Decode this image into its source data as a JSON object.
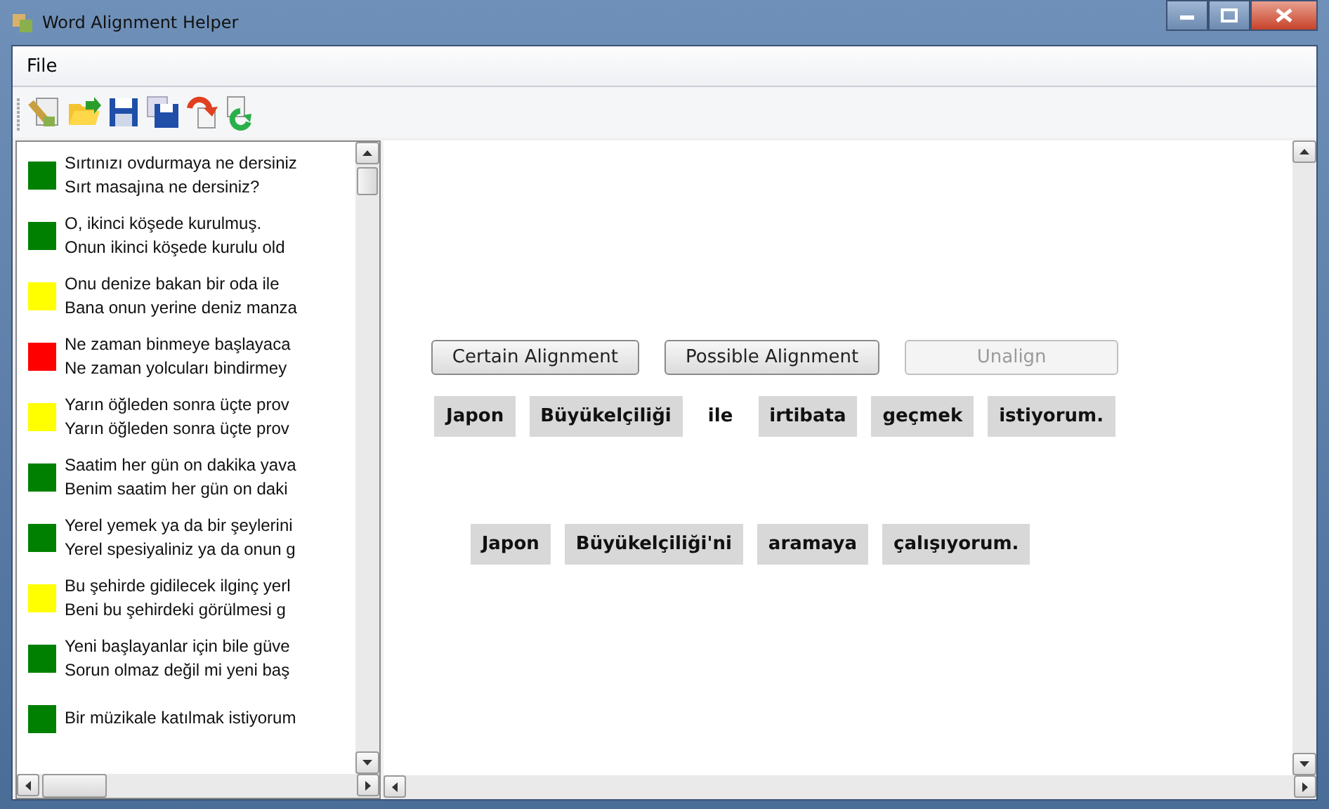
{
  "window": {
    "title": "Word Alignment Helper"
  },
  "menu": [
    "File"
  ],
  "sentences": [
    {
      "color": "#008000",
      "source": "Sırtınızı ovdurmaya ne dersiniz",
      "target": "Sırt masajına ne dersiniz?"
    },
    {
      "color": "#008000",
      "source": "O, ikinci köşede kurulmuş.",
      "target": "Onun ikinci köşede kurulu old"
    },
    {
      "color": "#ffff00",
      "source": "Onu denize bakan bir oda ile",
      "target": "Bana onun yerine deniz manza"
    },
    {
      "color": "#ff0000",
      "source": "Ne zaman binmeye başlayaca",
      "target": "Ne zaman yolcuları bindirmey"
    },
    {
      "color": "#ffff00",
      "source": "Yarın öğleden sonra üçte prov",
      "target": "Yarın öğleden sonra üçte prov"
    },
    {
      "color": "#008000",
      "source": "Saatim her gün on dakika yava",
      "target": "Benim saatim her gün on daki"
    },
    {
      "color": "#008000",
      "source": "Yerel yemek ya da bir şeylerini",
      "target": "Yerel spesiyaliniz ya da onun g"
    },
    {
      "color": "#ffff00",
      "source": "Bu şehirde gidilecek ilginç yerl",
      "target": "Beni bu şehirdeki görülmesi g"
    },
    {
      "color": "#008000",
      "source": "Yeni başlayanlar için bile güve",
      "target": "Sorun olmaz değil mi yeni baş"
    },
    {
      "color": "#008000",
      "source": "Bir müzikale katılmak istiyorum"
    }
  ],
  "buttons": [
    {
      "label": "Certain Alignment",
      "disabled": false
    },
    {
      "label": "Possible Alignment",
      "disabled": false
    },
    {
      "label": "Unalign",
      "disabled": true
    }
  ],
  "source_words": [
    {
      "text": "Japon",
      "highlighted": true
    },
    {
      "text": "Büyükelçiliği",
      "highlighted": true
    },
    {
      "text": "ile",
      "highlighted": false
    },
    {
      "text": "irtibata",
      "highlighted": true
    },
    {
      "text": "geçmek",
      "highlighted": true
    },
    {
      "text": "istiyorum.",
      "highlighted": true
    }
  ],
  "target_words": [
    {
      "text": "Japon",
      "highlighted": true
    },
    {
      "text": "Büyükelçiliği'ni",
      "highlighted": true
    },
    {
      "text": "aramaya",
      "highlighted": true
    },
    {
      "text": "çalışıyorum.",
      "highlighted": true
    }
  ]
}
